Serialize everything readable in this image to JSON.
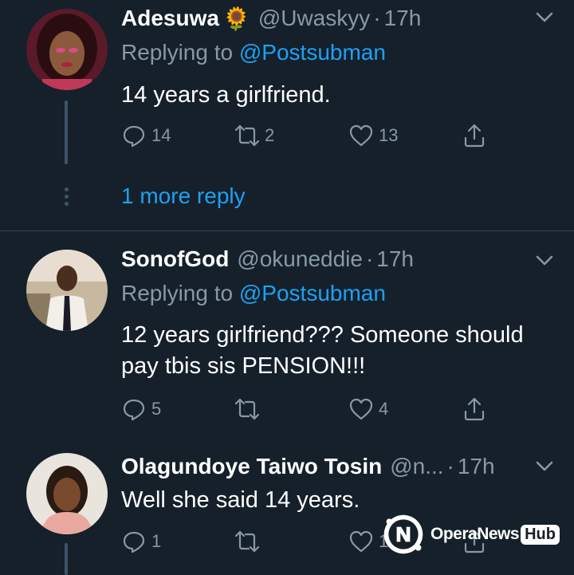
{
  "tweets": [
    {
      "name": "Adesuwa",
      "name_emoji": "🌻",
      "handle": "@Uwaskyy",
      "time": "17h",
      "replying_label": "Replying to",
      "replying_handle": "@Postsubman",
      "text": "14 years a girlfriend.",
      "replies": "14",
      "retweets": "2",
      "likes": "13"
    },
    {
      "name": "SonofGod",
      "handle": "@okuneddie",
      "time": "17h",
      "replying_label": "Replying to",
      "replying_handle": "@Postsubman",
      "text": "12 years girlfriend??? Someone should pay tbis sis PENSION!!!",
      "replies": "5",
      "retweets": "",
      "likes": "4"
    },
    {
      "name": "Olagundoye Taiwo Tosin",
      "handle": "@n...",
      "time": "17h",
      "text": "Well she said 14 years.",
      "replies": "1",
      "retweets": "",
      "likes": "10"
    }
  ],
  "more_replies": "1 more reply",
  "watermark": {
    "brand": "OperaNews",
    "hub": "Hub"
  },
  "colors": {
    "background": "#15202b",
    "secondary_text": "#8899a6",
    "link": "#1da1f2",
    "divider": "#38444d"
  }
}
